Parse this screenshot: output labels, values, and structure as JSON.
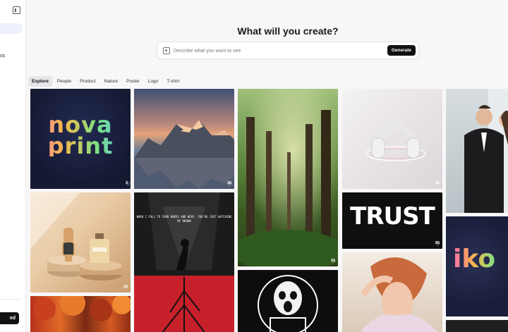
{
  "sidebar": {
    "partial_label": "os",
    "bottom_button_label": "ed"
  },
  "header": {
    "title": "What will you create?",
    "search": {
      "placeholder": "Describe what you want to see",
      "value": ""
    },
    "generate_label": "Generate"
  },
  "tabs": [
    {
      "label": "Explore",
      "active": true
    },
    {
      "label": "People",
      "active": false
    },
    {
      "label": "Product",
      "active": false
    },
    {
      "label": "Nature",
      "active": false
    },
    {
      "label": "Poster",
      "active": false
    },
    {
      "label": "Logo",
      "active": false
    },
    {
      "label": "T-shirt",
      "active": false
    }
  ],
  "gallery": {
    "novaprint": {
      "line1": "nova",
      "line2": "print",
      "likes": "3"
    },
    "mountain": {
      "likes": "28"
    },
    "forest": {
      "likes": "15"
    },
    "headphones": {
      "likes": "11"
    },
    "trust": {
      "text": "TRUST",
      "likes": "55"
    },
    "watch": {
      "likes": "15"
    },
    "poster": {
      "text": "WHEN I FALL TO YOUR KNEES AND WEEP, YOU'RE JUST WATCHING MY DROWN"
    },
    "iko": {
      "text": "iko"
    }
  },
  "colors": {
    "accent": "#111111",
    "active_tab_bg": "#e4e5e9",
    "sidebar_active_bg": "#eef0fb"
  }
}
